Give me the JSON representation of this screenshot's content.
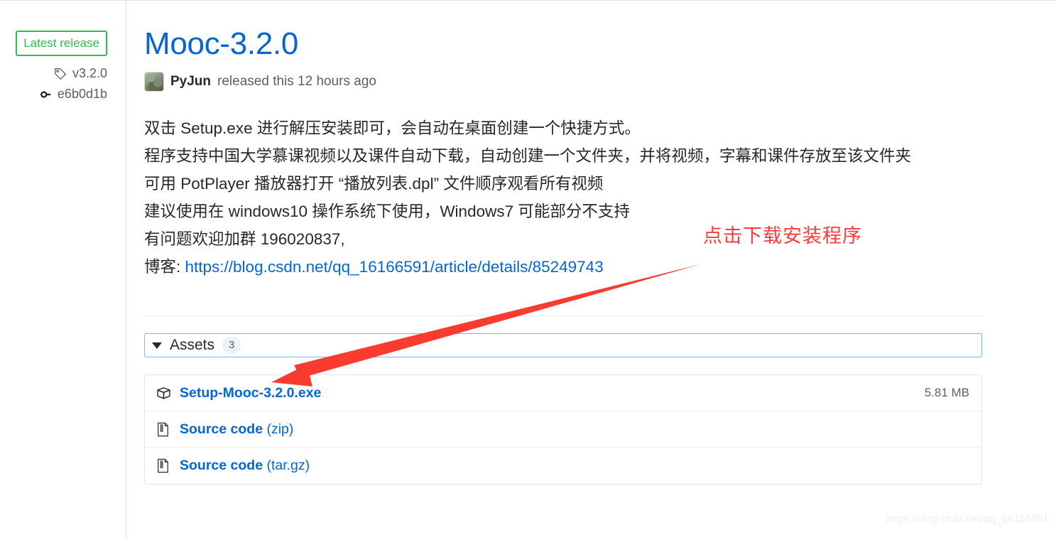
{
  "sidebar": {
    "badge_label": "Latest release",
    "badge_color": "#2cbe4e",
    "tag": {
      "icon": "tag-icon",
      "label": "v3.2.0"
    },
    "commit": {
      "icon": "commit-icon",
      "label": "e6b0d1b"
    }
  },
  "release": {
    "title": "Mooc-3.2.0",
    "title_color": "#0366d6",
    "author": "PyJun",
    "released_text": "released this 12 hours ago",
    "avatar": "user-avatar"
  },
  "body": {
    "lines": [
      "双击 Setup.exe 进行解压安装即可，会自动在桌面创建一个快捷方式。",
      "程序支持中国大学慕课视频以及课件自动下载，自动创建一个文件夹，并将视频，字幕和课件存放至该文件夹",
      "可用 PotPlayer 播放器打开 “播放列表.dpl” 文件顺序观看所有视频",
      "建议使用在 windows10 操作系统下使用，Windows7 可能部分不支持",
      "有问题欢迎加群 196020837,"
    ],
    "blog_label": "博客: ",
    "blog_url": "https://blog.csdn.net/qq_16166591/article/details/85249743"
  },
  "assets": {
    "toggle_icon": "caret-down-icon",
    "label": "Assets",
    "count": "3",
    "rows": [
      {
        "icon": "package-icon",
        "name": "Setup-Mooc-3.2.0.exe",
        "suffix": "",
        "size": "5.81 MB"
      },
      {
        "icon": "zip-file-icon",
        "name": "Source code",
        "suffix": " (zip)",
        "size": ""
      },
      {
        "icon": "zip-file-icon",
        "name": "Source code",
        "suffix": " (tar.gz)",
        "size": ""
      }
    ]
  },
  "annotation": {
    "text": "点击下载安装程序",
    "color": "#fb3b3b",
    "arrow": "red-arrow-pointing-to-setup-exe"
  },
  "watermark": {
    "text": "https://blog.csdn.net/qq_16166591"
  }
}
